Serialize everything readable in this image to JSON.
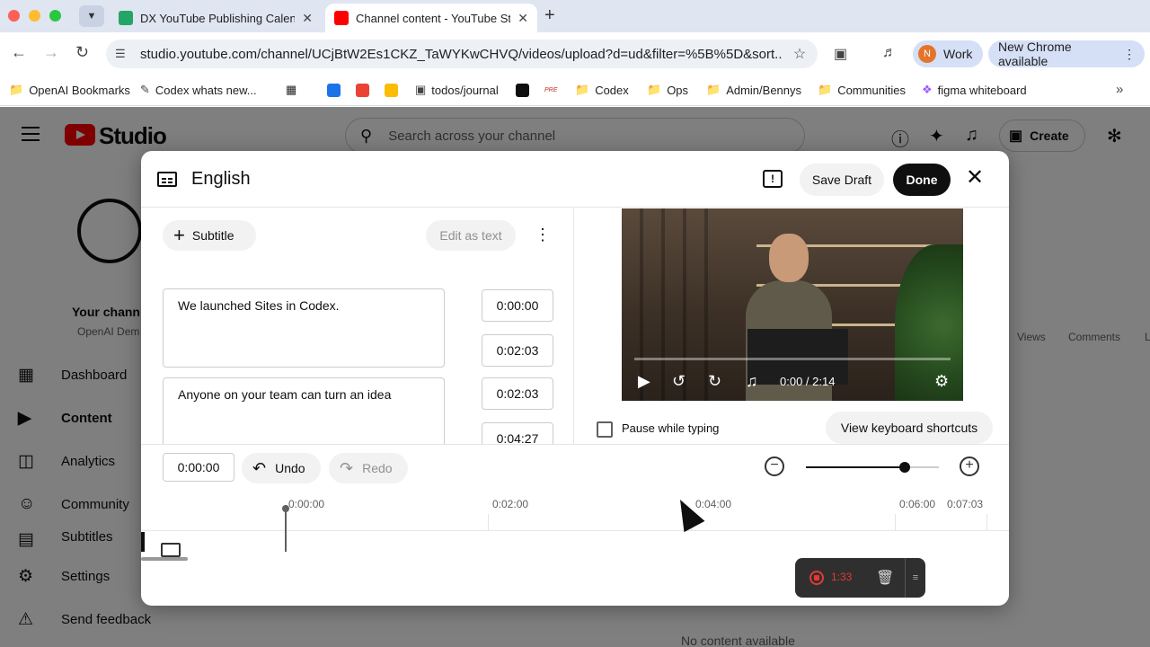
{
  "browser": {
    "tabs": [
      {
        "title": "DX YouTube Publishing Calendar",
        "active": false,
        "favicon": "sheets-icon"
      },
      {
        "title": "Channel content - YouTube Studio",
        "active": true,
        "favicon": "youtube-icon"
      }
    ],
    "url": "studio.youtube.com/channel/UCjBtW2Es1CKZ_TaWYKwCHVQ/videos/upload?d=ud&filter=%5B%5D&sort...",
    "profile_label": "Work",
    "profile_initial": "N",
    "update_label": "New Chrome available",
    "bookmarks": [
      {
        "label": "OpenAI Bookmarks",
        "icon": "folder-icon"
      },
      {
        "label": "Codex whats new...",
        "icon": "pen-icon"
      },
      {
        "label": "todos/journal",
        "icon": "notion-icon"
      },
      {
        "label": "Codex",
        "icon": "folder-icon"
      },
      {
        "label": "Ops",
        "icon": "folder-icon"
      },
      {
        "label": "Admin/Bennys",
        "icon": "folder-icon"
      },
      {
        "label": "Communities",
        "icon": "folder-icon"
      },
      {
        "label": "figma whiteboard",
        "icon": "figma-icon"
      }
    ],
    "bookmark_small_text": "PRE"
  },
  "studio": {
    "logo_text": "Studio",
    "search_placeholder": "Search across your channel",
    "create_label": "Create",
    "channel_name": "Your chann",
    "channel_sub": "OpenAI Dem",
    "nav": [
      {
        "label": "Dashboard",
        "icon": "dashboard-icon"
      },
      {
        "label": "Content",
        "icon": "content-icon",
        "active": true
      },
      {
        "label": "Analytics",
        "icon": "analytics-icon"
      },
      {
        "label": "Community",
        "icon": "community-icon"
      },
      {
        "label": "Subtitles",
        "icon": "subtitles-icon"
      },
      {
        "label": "Settings",
        "icon": "gear-icon"
      },
      {
        "label": "Send feedback",
        "icon": "feedback-icon"
      }
    ],
    "table_headers": [
      "Views",
      "Comments",
      "L"
    ],
    "empty_text": "No content available"
  },
  "dialog": {
    "title": "English",
    "save_draft_label": "Save Draft",
    "done_label": "Done",
    "subtitle_button_label": "Subtitle",
    "edit_as_text_label": "Edit as text",
    "cues": [
      {
        "text": "We launched Sites in Codex.",
        "start": "0:00:00",
        "end": "0:02:03"
      },
      {
        "text": "Anyone on your team can turn an idea",
        "start": "0:02:03",
        "end": "0:04:27"
      }
    ],
    "player": {
      "time_display": "0:00 / 2:14",
      "progress": 0.0
    },
    "pause_while_typing_label": "Pause while typing",
    "pause_while_typing_checked": false,
    "keyboard_shortcuts_label": "View keyboard shortcuts",
    "timeline": {
      "current_time": "0:00:00",
      "undo_label": "Undo",
      "redo_label": "Redo",
      "zoom_level": 0.74,
      "ticks": [
        "0:00:00",
        "0:02:00",
        "0:04:00",
        "0:06:00",
        "0:07:03"
      ]
    }
  },
  "recorder": {
    "elapsed": "1:33"
  }
}
